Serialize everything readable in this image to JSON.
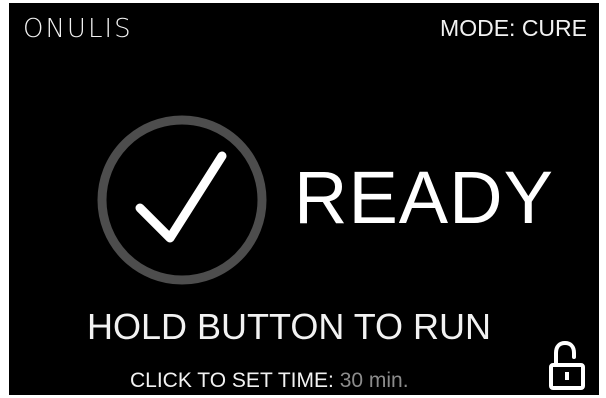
{
  "header": {
    "brand": "ONULIS",
    "mode_label": "MODE: CURE"
  },
  "status": {
    "icon": "checkmark-icon",
    "text": "READY"
  },
  "instruction": "HOLD BUTTON TO RUN",
  "timer": {
    "label": "CLICK TO SET TIME:",
    "value": "30 min."
  },
  "lock": {
    "icon": "unlocked-padlock-icon"
  },
  "colors": {
    "background": "#000000",
    "foreground": "#ffffff",
    "ring": "#4d4d4d",
    "muted": "#8c8c8c"
  }
}
